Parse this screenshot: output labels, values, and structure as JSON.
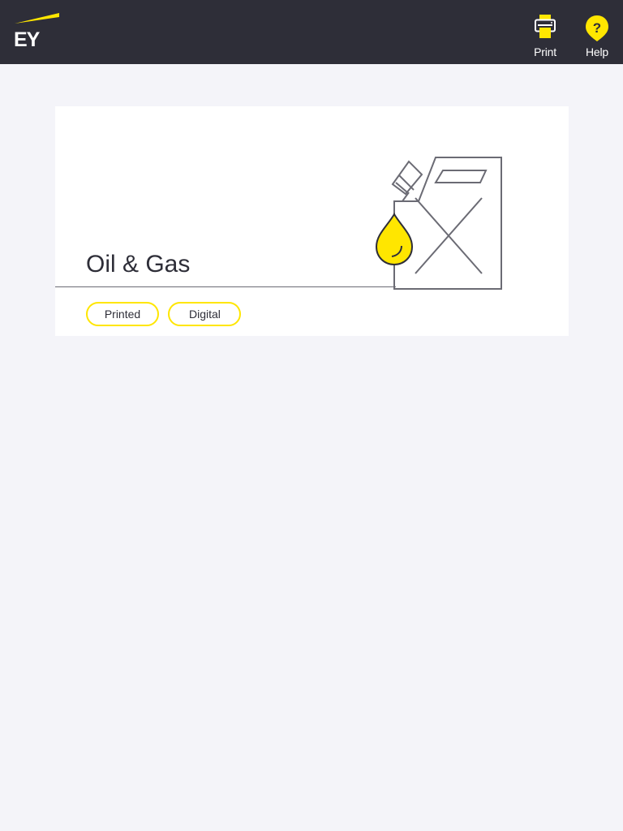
{
  "brand": {
    "logo_text": "EY",
    "accent_color": "#ffe600",
    "bar_color": "#2e2e38"
  },
  "toolbar": {
    "print": {
      "label": "Print",
      "icon": "printer-icon"
    },
    "help": {
      "label": "Help",
      "icon": "help-icon"
    }
  },
  "card": {
    "title": "Oil & Gas",
    "illustration": "oil-canister-icon",
    "tags": [
      "Printed",
      "Digital"
    ]
  }
}
